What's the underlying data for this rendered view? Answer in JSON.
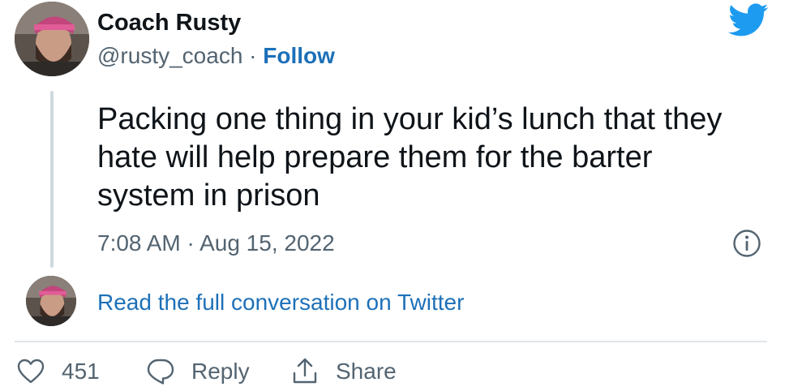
{
  "author": {
    "name": "Coach Rusty",
    "handle": "@rusty_coach",
    "separator": " · ",
    "follow_label": "Follow"
  },
  "tweet": {
    "text": "Packing one thing in your kid’s lunch that they\nhate will help prepare them for the barter\nsystem in prison",
    "timestamp": "7:08 AM · Aug 15, 2022"
  },
  "conversation_link": "Read the full conversation on Twitter",
  "actions": {
    "like_count": "451",
    "reply_label": "Reply",
    "share_label": "Share"
  },
  "colors": {
    "link": "#1d70b8",
    "twitter_blue": "#1d9bf0",
    "muted": "#536471",
    "thread_line": "#cfd9de"
  },
  "icons": {
    "brand": "twitter-bird-icon",
    "info": "info-icon",
    "like": "heart-icon",
    "reply": "speech-bubble-icon",
    "share": "share-arrow-icon"
  }
}
